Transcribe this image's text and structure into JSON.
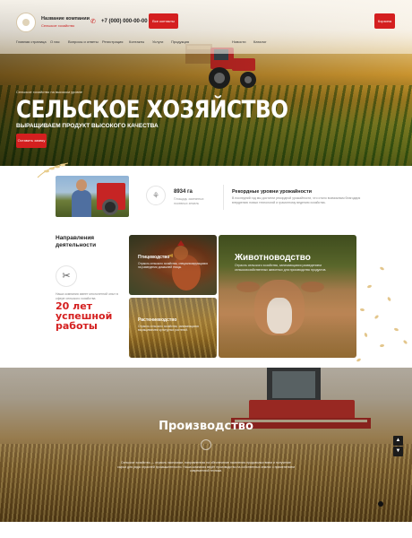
{
  "header": {
    "company_name": "Название компании",
    "company_tagline": "Сельское хозяйство",
    "phone": "+7 (000) 000-00-00",
    "contacts_button": "Все контакты",
    "cart_button": "Корзина"
  },
  "nav": {
    "items": [
      "Главная страница",
      "О нас",
      "Вопросы и ответы",
      "Регистрация",
      "Контакты",
      "Услуги",
      "Продукция",
      "Новости",
      "Каталог"
    ]
  },
  "hero": {
    "kicker": "Сельское хозяйство на высоком уровне",
    "title": "СЕЛЬСКОЕ ХОЗЯЙСТВО",
    "subtitle": "ВЫРАЩИВАЕМ ПРОДУКТ ВЫСОКОГО КАЧЕСТВА",
    "order_button": "Оставить заявку"
  },
  "stats": {
    "area_value": "8934 га",
    "area_desc": "Площадь засеянных посевных земель",
    "record_title": "Рекордные уровни урожайности",
    "record_desc": "В последний год мы достигли рекордной урожайности, что стало возможным благодаря внедрению новых технологий и грамотному ведению хозяйства."
  },
  "directions": {
    "title": "Направления деятельности",
    "desc": "Наша компания имеет многолетний опыт в сфере сельского хозяйства",
    "years": "20 лет успешной работы",
    "cards": [
      {
        "title": "Птицеводство",
        "desc": "Отрасль сельского хозяйства, специализирующаяся на разведении домашней птицы."
      },
      {
        "title": "Растениеводство",
        "desc": "Отрасль сельского хозяйства, занимающаяся выращиванием культурных растений."
      },
      {
        "title": "Животноводство",
        "desc": "Отрасль сельского хозяйства, занимающаяся разведением сельскохозяйственных животных для производства продуктов."
      }
    ]
  },
  "production": {
    "title": "Производство",
    "desc": "Сельское хозяйство — отрасль экономики, направленная на обеспечение населения продовольствием и получение сырья для ряда отраслей промышленности. Наша компания ведёт производство на собственных землях с применением современной техники."
  },
  "controls": {
    "up_icon": "chevron-up-icon",
    "down_icon": "chevron-down-icon"
  },
  "colors": {
    "accent": "#d41f1f"
  }
}
